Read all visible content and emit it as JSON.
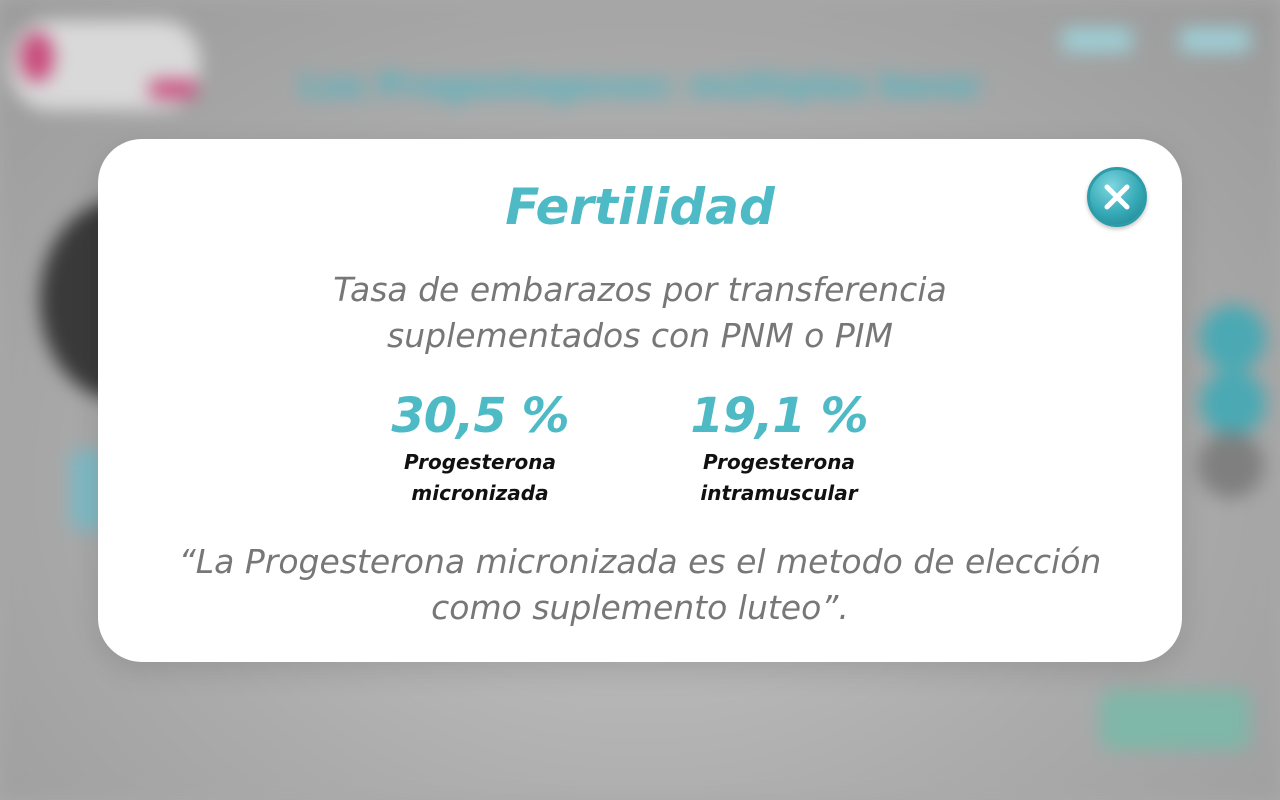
{
  "background": {
    "headline": "Los Progestagenos: múltiples beneficios"
  },
  "modal": {
    "title": "Fertilidad",
    "subtitle_lines": [
      "Tasa de embarazos por transferencia",
      "suplementados con PNM o PIM"
    ],
    "stats": [
      {
        "value": "30,5 %",
        "label_lines": [
          "Progesterona",
          "micronizada"
        ]
      },
      {
        "value": "19,1 %",
        "label_lines": [
          "Progesterona",
          "intramuscular"
        ]
      }
    ],
    "quote_lines": [
      "“La Progesterona micronizada es el metodo de elección",
      "como suplemento luteo”."
    ],
    "close_icon": "close-x-icon"
  },
  "colors": {
    "accent": "#4dbac6",
    "text_muted": "#777777",
    "text_dark": "#111111",
    "modal_bg": "#ffffff",
    "overlay": "#a9a9a9"
  }
}
